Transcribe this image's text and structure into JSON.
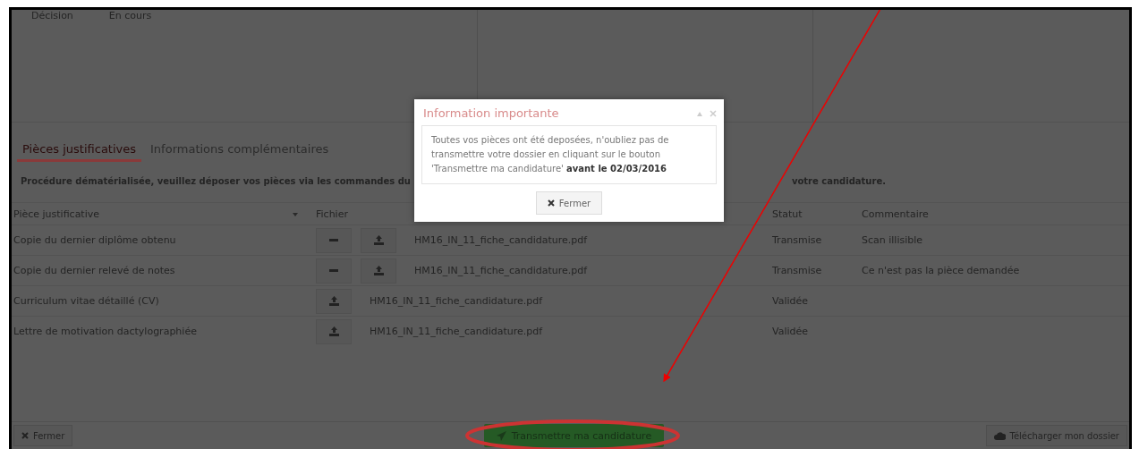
{
  "header": {
    "label": "Décision",
    "value": "En cours"
  },
  "tabs": [
    {
      "label": "Pièces justificatives",
      "selected": true
    },
    {
      "label": "Informations complémentaires",
      "selected": false
    }
  ],
  "instruction": {
    "left": "Procédure dématérialisée, veuillez déposer vos pièces via les commandes du",
    "right": "votre candidature."
  },
  "table": {
    "columns": [
      "Pièce justificative",
      "Fichier",
      "Statut",
      "Commentaire"
    ],
    "rows": [
      {
        "name": "Copie du dernier diplôme obtenu",
        "deletable": true,
        "file": "HM16_IN_11_fiche_candidature.pdf",
        "status": "Transmise",
        "comment": "Scan illisible"
      },
      {
        "name": "Copie du dernier relevé de notes",
        "deletable": true,
        "file": "HM16_IN_11_fiche_candidature.pdf",
        "status": "Transmise",
        "comment": "Ce n'est pas la pièce demandée"
      },
      {
        "name": "Curriculum vitae détaillé (CV)",
        "deletable": false,
        "file": "HM16_IN_11_fiche_candidature.pdf",
        "status": "Validée",
        "comment": ""
      },
      {
        "name": "Lettre de motivation dactylographiée",
        "deletable": false,
        "file": "HM16_IN_11_fiche_candidature.pdf",
        "status": "Validée",
        "comment": ""
      }
    ]
  },
  "footer": {
    "close": "Fermer",
    "submit": "Transmettre ma candidature",
    "download": "Télécharger mon dossier"
  },
  "modal": {
    "title": "Information importante",
    "message": "Toutes vos pièces ont été deposées, n'oubliez pas de transmettre votre dossier en cliquant sur le bouton 'Transmettre ma candidature' **avant le 02/03/2016**",
    "button": "Fermer"
  }
}
